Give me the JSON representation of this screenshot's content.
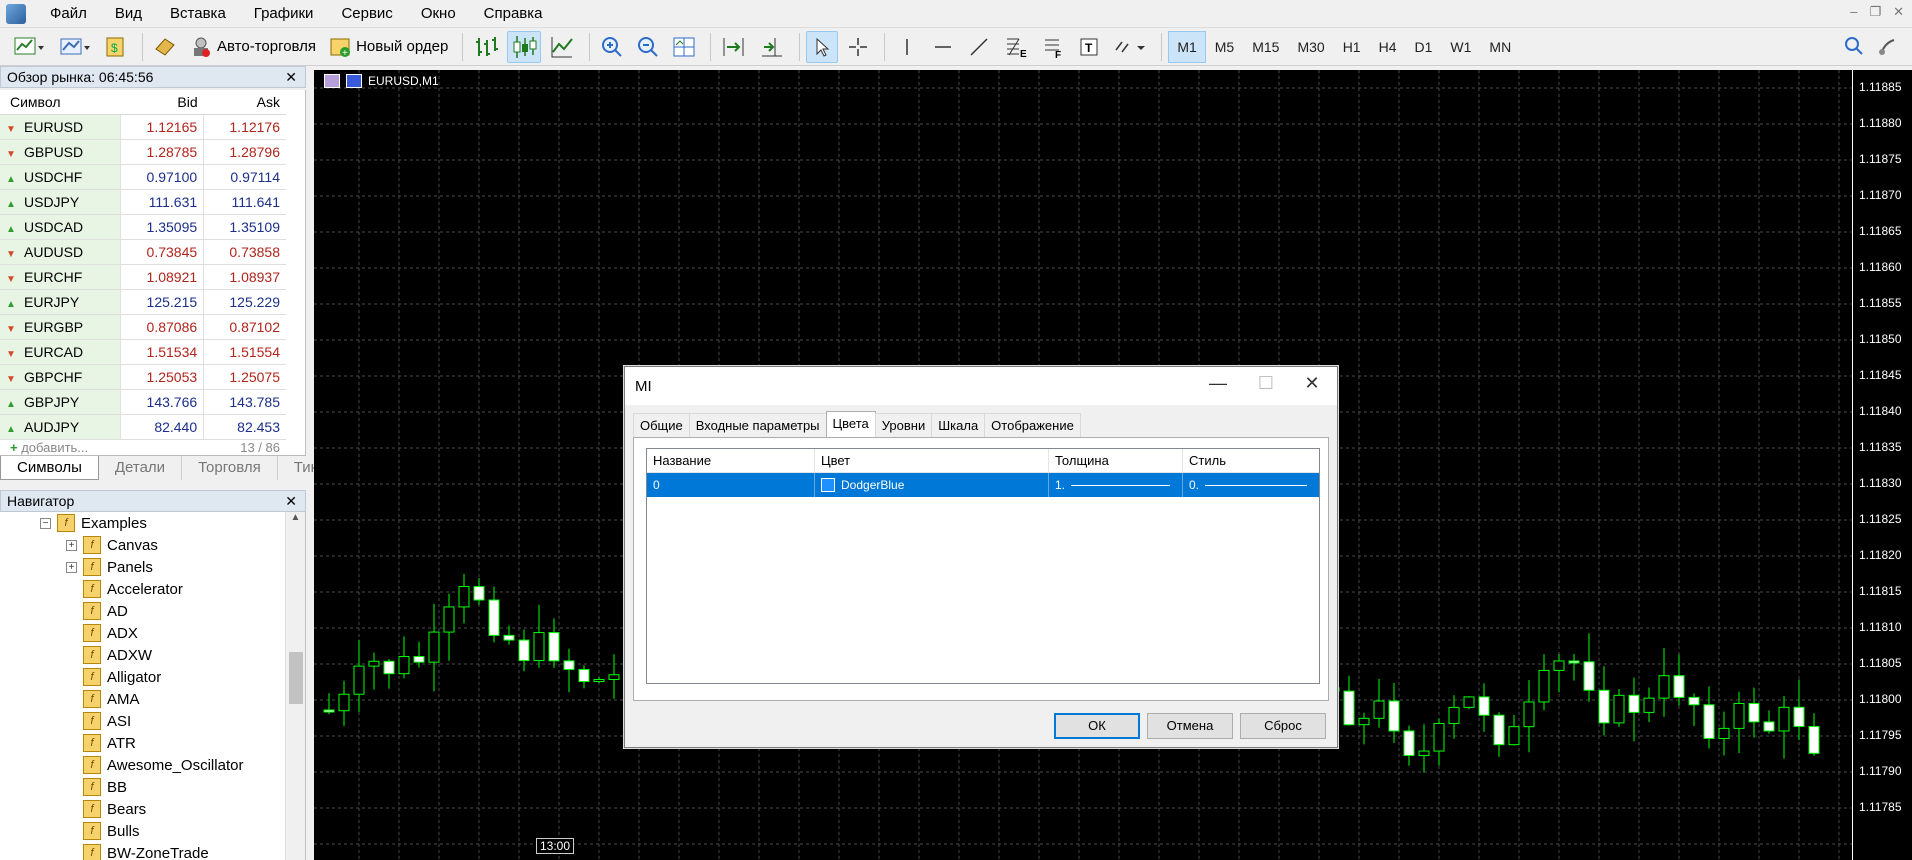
{
  "menu": [
    "Файл",
    "Вид",
    "Вставка",
    "Графики",
    "Сервис",
    "Окно",
    "Справка"
  ],
  "toolbar": {
    "auto_trading": "Авто-торговля",
    "new_order": "Новый ордер",
    "timeframes": [
      "M1",
      "M5",
      "M15",
      "M30",
      "H1",
      "H4",
      "D1",
      "W1",
      "MN"
    ],
    "active_timeframe": "M1"
  },
  "market_watch": {
    "title": "Обзор рынка: 06:45:56",
    "col_symbol": "Символ",
    "col_bid": "Bid",
    "col_ask": "Ask",
    "rows": [
      {
        "symbol": "EURUSD",
        "bid": "1.12165",
        "ask": "1.12176",
        "dir": "down"
      },
      {
        "symbol": "GBPUSD",
        "bid": "1.28785",
        "ask": "1.28796",
        "dir": "down"
      },
      {
        "symbol": "USDCHF",
        "bid": "0.97100",
        "ask": "0.97114",
        "dir": "up"
      },
      {
        "symbol": "USDJPY",
        "bid": "111.631",
        "ask": "111.641",
        "dir": "up"
      },
      {
        "symbol": "USDCAD",
        "bid": "1.35095",
        "ask": "1.35109",
        "dir": "up"
      },
      {
        "symbol": "AUDUSD",
        "bid": "0.73845",
        "ask": "0.73858",
        "dir": "down"
      },
      {
        "symbol": "EURCHF",
        "bid": "1.08921",
        "ask": "1.08937",
        "dir": "down"
      },
      {
        "symbol": "EURJPY",
        "bid": "125.215",
        "ask": "125.229",
        "dir": "up"
      },
      {
        "symbol": "EURGBP",
        "bid": "0.87086",
        "ask": "0.87102",
        "dir": "down"
      },
      {
        "symbol": "EURCAD",
        "bid": "1.51534",
        "ask": "1.51554",
        "dir": "down"
      },
      {
        "symbol": "GBPCHF",
        "bid": "1.25053",
        "ask": "1.25075",
        "dir": "down"
      },
      {
        "symbol": "GBPJPY",
        "bid": "143.766",
        "ask": "143.785",
        "dir": "up"
      },
      {
        "symbol": "AUDJPY",
        "bid": "82.440",
        "ask": "82.453",
        "dir": "up"
      }
    ],
    "add_label": "добавить...",
    "count": "13 / 86",
    "tabs": [
      "Символы",
      "Детали",
      "Торговля",
      "Тики"
    ]
  },
  "navigator": {
    "title": "Навигатор",
    "folder": "Examples",
    "subfolders": [
      "Canvas",
      "Panels"
    ],
    "items": [
      "Accelerator",
      "AD",
      "ADX",
      "ADXW",
      "Alligator",
      "AMA",
      "ASI",
      "ATR",
      "Awesome_Oscillator",
      "BB",
      "Bears",
      "Bulls",
      "BW-ZoneTrade"
    ]
  },
  "chart": {
    "title": "EURUSD,M1",
    "prices": [
      "1.11885",
      "1.11880",
      "1.11875",
      "1.11870",
      "1.11865",
      "1.11860",
      "1.11855",
      "1.11850",
      "1.11845",
      "1.11840",
      "1.11835",
      "1.11830",
      "1.11825",
      "1.11820",
      "1.11815",
      "1.11810",
      "1.11805",
      "1.11800",
      "1.11795",
      "1.11790",
      "1.11785"
    ],
    "time_label": "13:00",
    "bull_color": "#00ff00",
    "bear_color": "#ffffff"
  },
  "dialog": {
    "title": "MI",
    "tabs": [
      "Общие",
      "Входные параметры",
      "Цвета",
      "Уровни",
      "Шкала",
      "Отображение"
    ],
    "active_tab": "Цвета",
    "columns": [
      "Название",
      "Цвет",
      "Толщина",
      "Стиль"
    ],
    "row": {
      "name": "0",
      "color": "DodgerBlue",
      "color_hex": "#1e90ff",
      "width": "1.",
      "style": "0."
    },
    "ok": "ОК",
    "cancel": "Отмена",
    "reset": "Сброс"
  }
}
